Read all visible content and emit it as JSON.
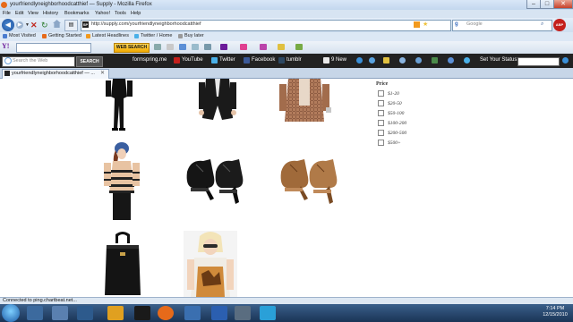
{
  "window": {
    "title": "yourfriendlyneighborhoodcatthief — Supply - Mozilla Firefox",
    "min": "–",
    "max": "□",
    "close": "✕"
  },
  "menu": [
    "File",
    "Edit",
    "View",
    "History",
    "Bookmarks",
    "Yahoo!",
    "Tools",
    "Help"
  ],
  "nav": {
    "url": "http://supply.com/yourfriendlyneighborhoodcatthief",
    "search_placeholder": "Google"
  },
  "bookmarks": [
    "Most Visited",
    "Getting Started",
    "Latest Headlines",
    "Twitter / Home",
    "Buy later"
  ],
  "yahoo_toolbar": {
    "search_button": "WEB SEARCH"
  },
  "dark_toolbar": {
    "search_placeholder": "Search the Web",
    "search_button": "SEARCH",
    "links": [
      "formspring.me",
      "YouTube",
      "Twitter",
      "Facebook",
      "tumblr",
      "9 New"
    ],
    "status_label": "Set Your Status:"
  },
  "tab": {
    "title": "yourfriendlyneighborhoodcatthief — ..."
  },
  "filter": {
    "title": "Price",
    "options": [
      "$1-20",
      "$20-50",
      "$50-100",
      "$100-200",
      "$200-500",
      "$500+"
    ]
  },
  "statusbar": {
    "text": "Connected to ping.chartbeat.net..."
  },
  "taskbar": {
    "time": "7:14 PM",
    "date": "12/15/2010"
  },
  "colors": {
    "firefox_orange": "#e66a1a",
    "yahoo_purple": "#6b1b9a",
    "dark_toolbar": "#222222"
  }
}
